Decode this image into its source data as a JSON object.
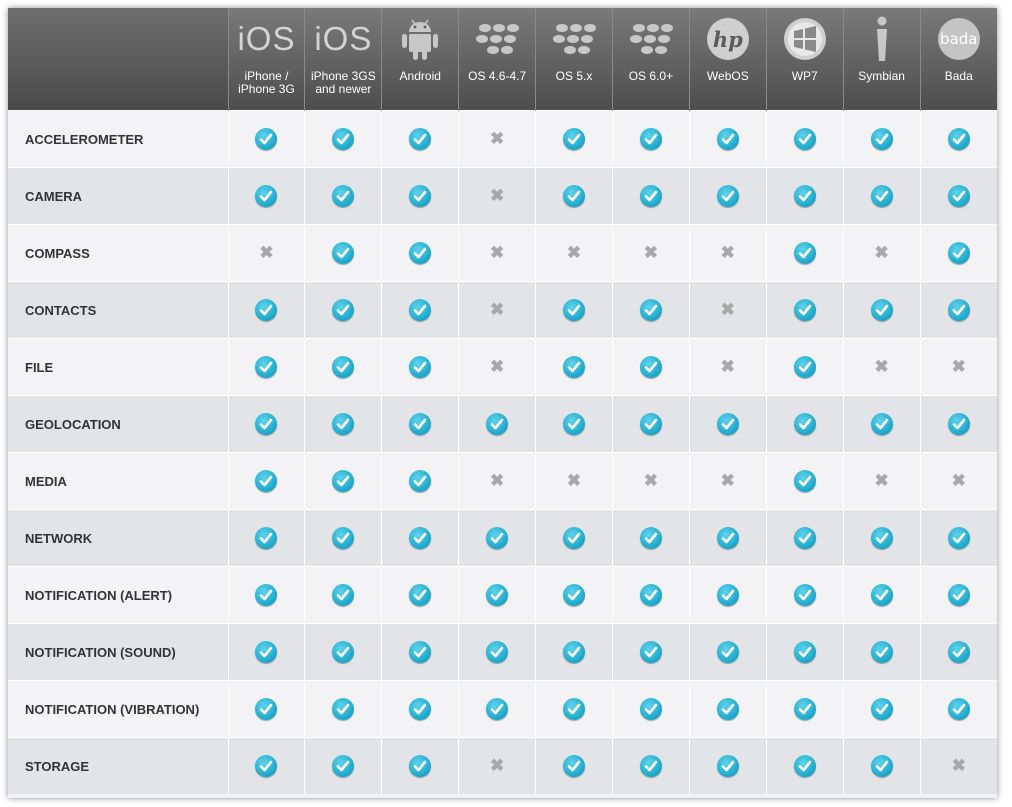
{
  "platforms": [
    {
      "label": "iPhone / iPhone 3G",
      "logo": "iOS",
      "icon": "ios-logo-icon"
    },
    {
      "label": "iPhone 3GS and newer",
      "logo": "iOS",
      "icon": "ios-logo-icon"
    },
    {
      "label": "Android",
      "logo": "",
      "icon": "android-logo-icon"
    },
    {
      "label": "OS 4.6-4.7",
      "logo": "",
      "icon": "blackberry-logo-icon"
    },
    {
      "label": "OS 5.x",
      "logo": "",
      "icon": "blackberry-logo-icon"
    },
    {
      "label": "OS 6.0+",
      "logo": "",
      "icon": "blackberry-logo-icon"
    },
    {
      "label": "WebOS",
      "logo": "hp",
      "icon": "hp-logo-icon"
    },
    {
      "label": "WP7",
      "logo": "",
      "icon": "windows-logo-icon"
    },
    {
      "label": "Symbian",
      "logo": "",
      "icon": "symbian-logo-icon"
    },
    {
      "label": "Bada",
      "logo": "bada",
      "icon": "bada-logo-icon"
    }
  ],
  "features": [
    {
      "name": "ACCELEROMETER",
      "support": [
        true,
        true,
        true,
        false,
        true,
        true,
        true,
        true,
        true,
        true
      ]
    },
    {
      "name": "CAMERA",
      "support": [
        true,
        true,
        true,
        false,
        true,
        true,
        true,
        true,
        true,
        true
      ]
    },
    {
      "name": "COMPASS",
      "support": [
        false,
        true,
        true,
        false,
        false,
        false,
        false,
        true,
        false,
        true
      ]
    },
    {
      "name": "CONTACTS",
      "support": [
        true,
        true,
        true,
        false,
        true,
        true,
        false,
        true,
        true,
        true
      ]
    },
    {
      "name": "FILE",
      "support": [
        true,
        true,
        true,
        false,
        true,
        true,
        false,
        true,
        false,
        false
      ]
    },
    {
      "name": "GEOLOCATION",
      "support": [
        true,
        true,
        true,
        true,
        true,
        true,
        true,
        true,
        true,
        true
      ]
    },
    {
      "name": "MEDIA",
      "support": [
        true,
        true,
        true,
        false,
        false,
        false,
        false,
        true,
        false,
        false
      ]
    },
    {
      "name": "NETWORK",
      "support": [
        true,
        true,
        true,
        true,
        true,
        true,
        true,
        true,
        true,
        true
      ]
    },
    {
      "name": "NOTIFICATION (ALERT)",
      "support": [
        true,
        true,
        true,
        true,
        true,
        true,
        true,
        true,
        true,
        true
      ]
    },
    {
      "name": "NOTIFICATION (SOUND)",
      "support": [
        true,
        true,
        true,
        true,
        true,
        true,
        true,
        true,
        true,
        true
      ]
    },
    {
      "name": "NOTIFICATION (VIBRATION)",
      "support": [
        true,
        true,
        true,
        true,
        true,
        true,
        true,
        true,
        true,
        true
      ]
    },
    {
      "name": "STORAGE",
      "support": [
        true,
        true,
        true,
        false,
        true,
        true,
        true,
        true,
        true,
        false
      ]
    }
  ],
  "icons": {
    "supported": "check-icon",
    "unsupported": "cross-icon"
  },
  "colors": {
    "header_top": "#7a7a7a",
    "header_bottom": "#4d4d4d",
    "check": "#1aa6c9",
    "cross": "#a8a8a8",
    "row_light": "#f3f3f5",
    "row_dark": "#e3e4e7"
  }
}
